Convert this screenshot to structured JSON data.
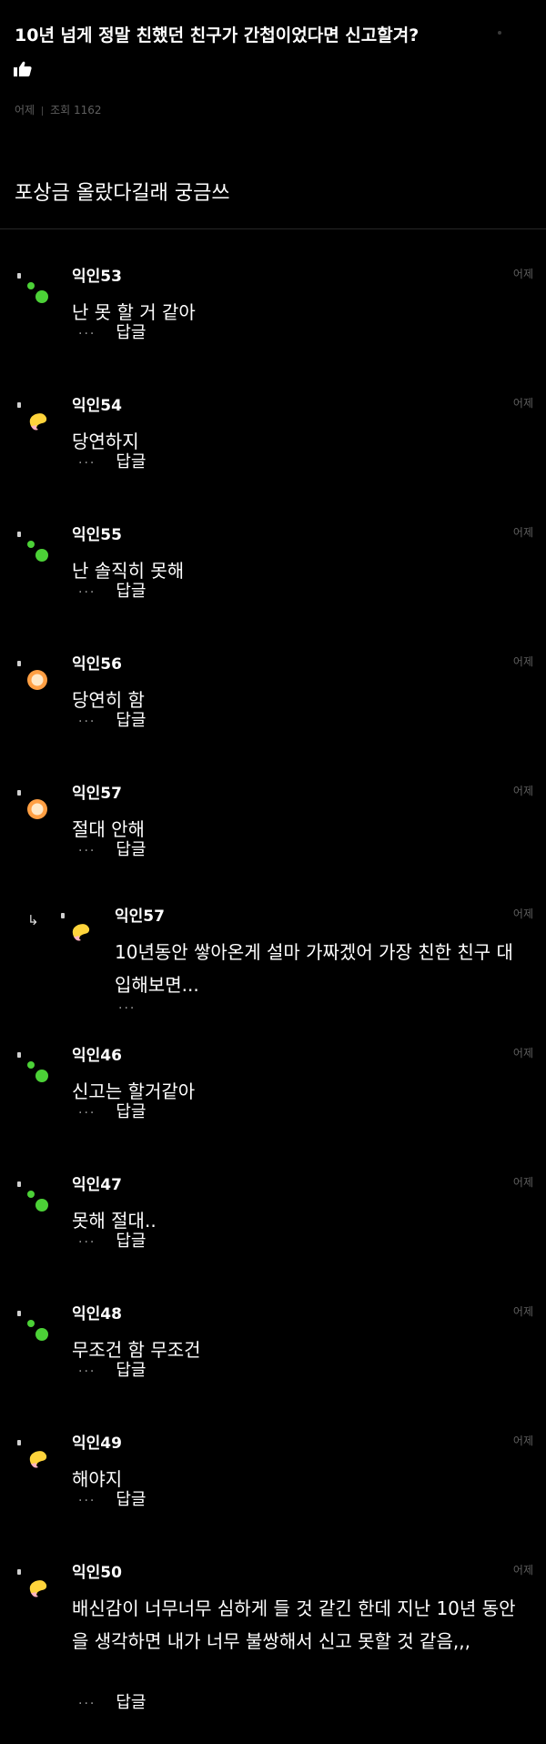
{
  "post": {
    "title": "10년 넘게 정말 친했던 친구가 간첩이었다면 신고할겨?",
    "time": "어제",
    "views": "조회 1162",
    "body": "포상금 올랐다길래 궁금쓰"
  },
  "labels": {
    "more": "···",
    "reply": "답글"
  },
  "colors": {
    "background": "#000000",
    "muted": "#5e5e5e",
    "green": "#4cd137",
    "yellow": "#ffd43b",
    "orange": "#ff9f43"
  },
  "comments": [
    {
      "avatar": "green-dots-icon",
      "nick": "익인53",
      "time": "어제",
      "text": "난 못 할 거 같아",
      "reply": false
    },
    {
      "avatar": "yellow-pink-blob-icon",
      "nick": "익인54",
      "time": "어제",
      "text": "당연하지",
      "reply": false
    },
    {
      "avatar": "green-dots-icon",
      "nick": "익인55",
      "time": "어제",
      "text": "난 솔직히 못해",
      "reply": false
    },
    {
      "avatar": "orange-circle-icon",
      "nick": "익인56",
      "time": "어제",
      "text": "당연히 함",
      "reply": false
    },
    {
      "avatar": "orange-circle-icon",
      "nick": "익인57",
      "time": "어제",
      "text": "절대 안해",
      "reply": false
    },
    {
      "avatar": "yellow-pink-blob-icon",
      "nick": "익인57",
      "time": "어제",
      "text": "10년동안 쌓아온게 설마 가짜겠어 가장 친한 친구 대입해보면...",
      "reply": true
    },
    {
      "avatar": "green-dots-icon",
      "nick": "익인46",
      "time": "어제",
      "text": "신고는 할거같아",
      "reply": false
    },
    {
      "avatar": "green-dots-icon",
      "nick": "익인47",
      "time": "어제",
      "text": "못해 절대..",
      "reply": false
    },
    {
      "avatar": "green-dots-icon",
      "nick": "익인48",
      "time": "어제",
      "text": "무조건 함 무조건",
      "reply": false
    },
    {
      "avatar": "yellow-pink-blob-icon",
      "nick": "익인49",
      "time": "어제",
      "text": "해야지",
      "reply": false
    },
    {
      "avatar": "yellow-pink-blob-icon",
      "nick": "익인50",
      "time": "어제",
      "text": "배신감이 너무너무 심하게 들 것 같긴 한데 지난 10년 동안을 생각하면 내가 너무 불쌍해서 신고 못할 것 같음,,,",
      "reply": false
    }
  ]
}
